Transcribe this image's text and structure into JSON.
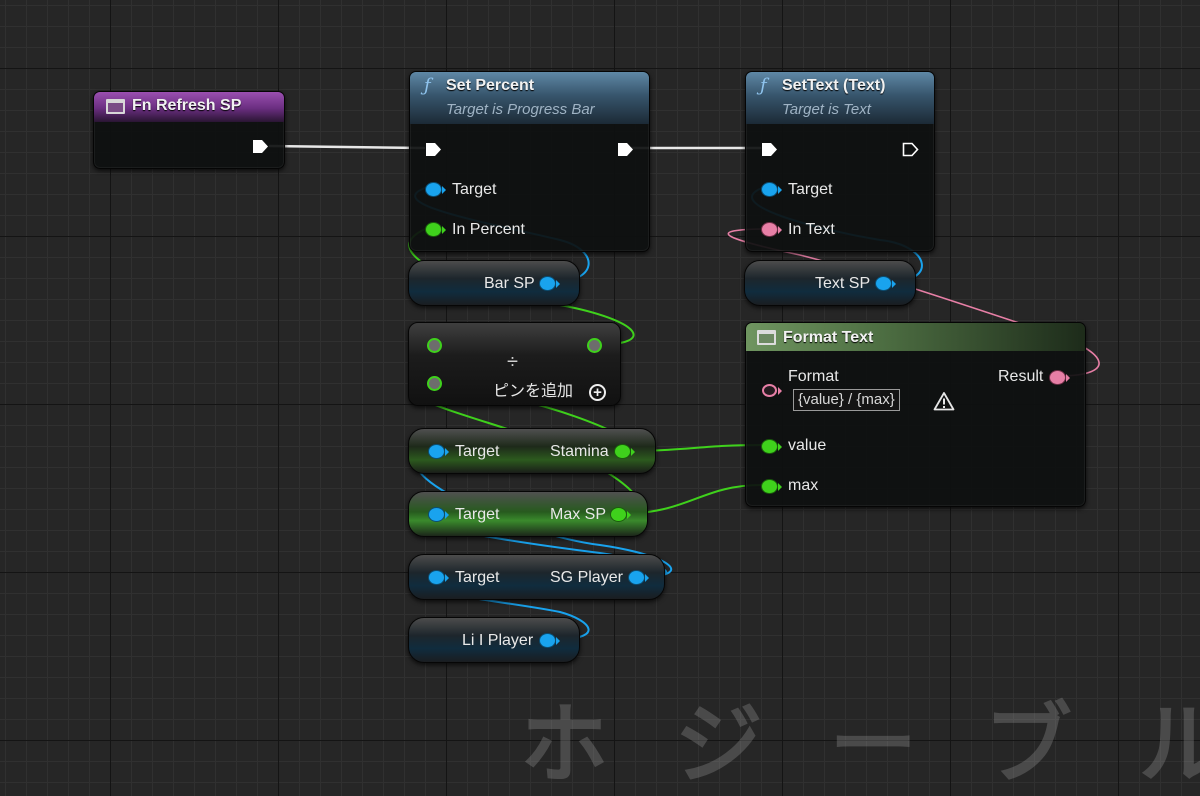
{
  "nodes": {
    "fn_refresh": {
      "title": "Fn Refresh SP"
    },
    "set_percent": {
      "title": "Set Percent",
      "subtitle": "Target is Progress Bar",
      "pins": {
        "target": "Target",
        "in_percent": "In Percent"
      }
    },
    "set_text": {
      "title": "SetText (Text)",
      "subtitle": "Target is Text",
      "pins": {
        "target": "Target",
        "in_text": "In Text"
      }
    },
    "format_text": {
      "title": "Format Text",
      "format_label": "Format",
      "format_value": "{value} / {max}",
      "result_label": "Result",
      "value_label": "value",
      "max_label": "max"
    },
    "bar_sp": {
      "label": "Bar SP"
    },
    "text_sp": {
      "label": "Text SP"
    },
    "divide": {
      "add_pin_label": "ピンを追加"
    },
    "get_stamina": {
      "target_label": "Target",
      "output_label": "Stamina"
    },
    "get_max_sp": {
      "target_label": "Target",
      "output_label": "Max SP"
    },
    "get_sg_player": {
      "target_label": "Target",
      "output_label": "SG Player"
    },
    "li_player": {
      "label": "Li I Player"
    }
  },
  "colors": {
    "exec": "#ffffff",
    "object_pin": "#19a3ee",
    "float_pin": "#3fd11c",
    "text_pin": "#e77fa6",
    "function_header": "#37556c",
    "event_header": "#6a2e80",
    "pure_header": "#4d6e42"
  },
  "watermark": "ホ ジ ー ブ ル"
}
